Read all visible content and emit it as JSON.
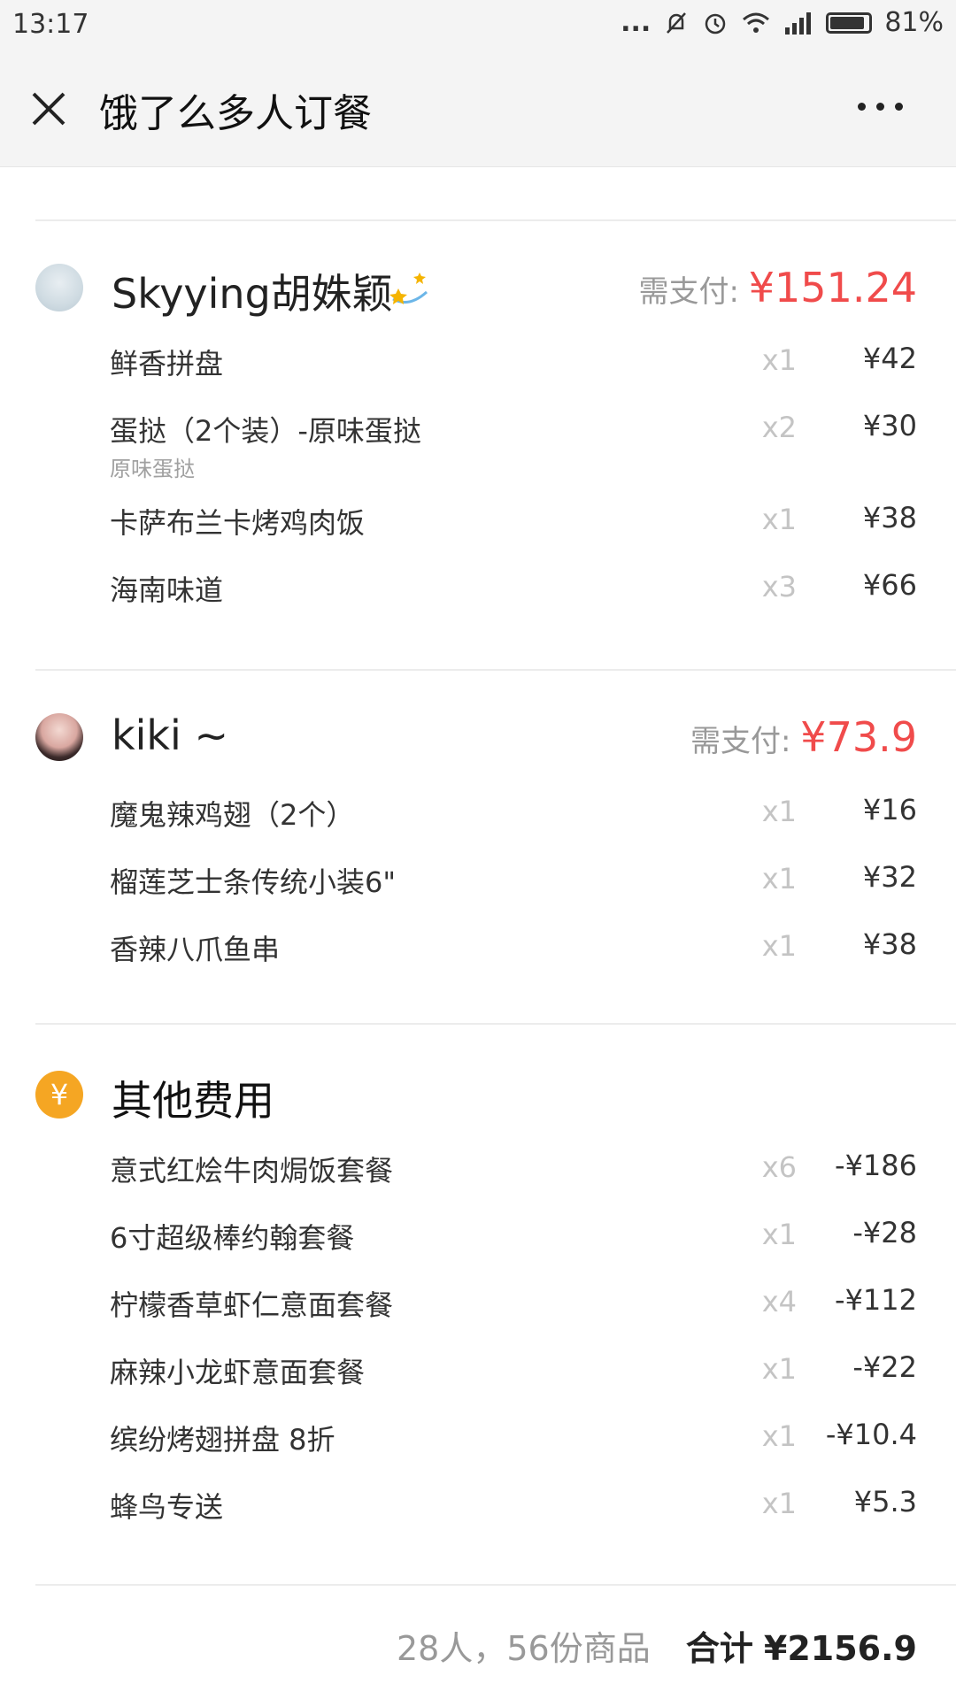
{
  "status_bar": {
    "time": "13:17",
    "battery": "81%",
    "dots": "..."
  },
  "header": {
    "title": "饿了么多人订餐"
  },
  "groups": [
    {
      "user": "Skyying胡姝颖",
      "pay_label": "需支付:",
      "pay_amount": "¥151.24",
      "items": [
        {
          "name": "鲜香拼盘",
          "qty": "x1",
          "price": "¥42"
        },
        {
          "name": "蛋挞（2个装）-原味蛋挞",
          "sub": "原味蛋挞",
          "qty": "x2",
          "price": "¥30"
        },
        {
          "name": "卡萨布兰卡烤鸡肉饭",
          "qty": "x1",
          "price": "¥38"
        },
        {
          "name": "海南味道",
          "qty": "x3",
          "price": "¥66"
        }
      ]
    },
    {
      "user": "kiki ~",
      "pay_label": "需支付:",
      "pay_amount": "¥73.9",
      "items": [
        {
          "name": "魔鬼辣鸡翅（2个）",
          "qty": "x1",
          "price": "¥16"
        },
        {
          "name": "榴莲芝士条传统小装6\"",
          "qty": "x1",
          "price": "¥32"
        },
        {
          "name": "香辣八爪鱼串",
          "qty": "x1",
          "price": "¥38"
        }
      ]
    },
    {
      "user": "其他费用",
      "icon_symbol": "¥",
      "items": [
        {
          "name": "意式红烩牛肉焗饭套餐",
          "qty": "x6",
          "price": "-¥186"
        },
        {
          "name": "6寸超级棒约翰套餐",
          "qty": "x1",
          "price": "-¥28"
        },
        {
          "name": "柠檬香草虾仁意面套餐",
          "qty": "x4",
          "price": "-¥112"
        },
        {
          "name": "麻辣小龙虾意面套餐",
          "qty": "x1",
          "price": "-¥22"
        },
        {
          "name": "缤纷烤翅拼盘 8折",
          "qty": "x1",
          "price": "-¥10.4"
        },
        {
          "name": "蜂鸟专送",
          "qty": "x1",
          "price": "¥5.3"
        }
      ]
    }
  ],
  "summary": {
    "count": "28人，56份商品",
    "total_label": "合计",
    "total": "¥2156.9"
  },
  "colors": {
    "accent_red": "#f04b4b",
    "yen_icon": "#f5a623"
  }
}
